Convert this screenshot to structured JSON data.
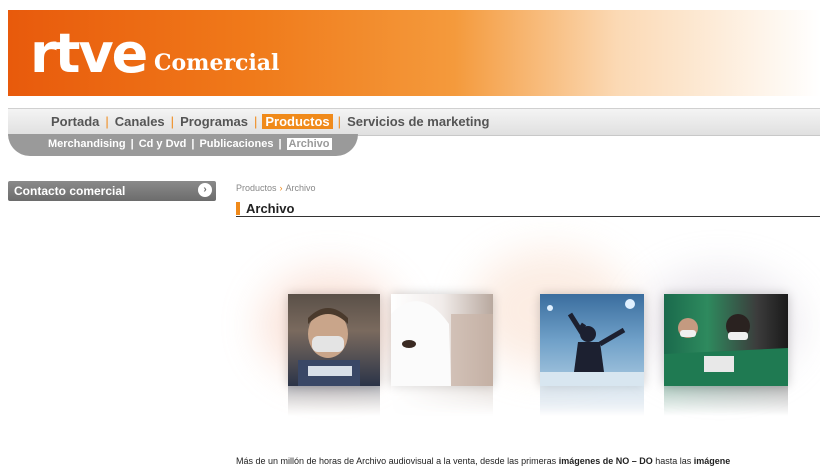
{
  "brand": {
    "logo": "rtve",
    "subtitle": "Comercial"
  },
  "nav": {
    "items": [
      {
        "label": "Portada"
      },
      {
        "label": "Canales"
      },
      {
        "label": "Programas"
      },
      {
        "label": "Productos",
        "active": true
      },
      {
        "label": "Servicios de marketing"
      }
    ]
  },
  "subnav": {
    "items": [
      {
        "label": "Merchandising"
      },
      {
        "label": "Cd y Dvd"
      },
      {
        "label": "Publicaciones"
      },
      {
        "label": "Archivo",
        "active": true
      }
    ]
  },
  "sidebar": {
    "contact_label": "Contacto comercial"
  },
  "breadcrumb": {
    "parent": "Productos",
    "current": "Archivo"
  },
  "page": {
    "title": "Archivo",
    "body_part1": "Más de un millón de horas de Archivo audiovisual a la venta, desde las primeras ",
    "body_bold1": "imágenes de NO – DO",
    "body_part2": " hasta las ",
    "body_bold2": "imágene"
  },
  "photos": [
    {
      "name": "protester-masked"
    },
    {
      "name": "hooded-figure"
    },
    {
      "name": "rock-singer"
    },
    {
      "name": "crowd-masks-green"
    }
  ],
  "colors": {
    "accent": "#f08a1a",
    "brand_orange": "#e85a0c"
  }
}
